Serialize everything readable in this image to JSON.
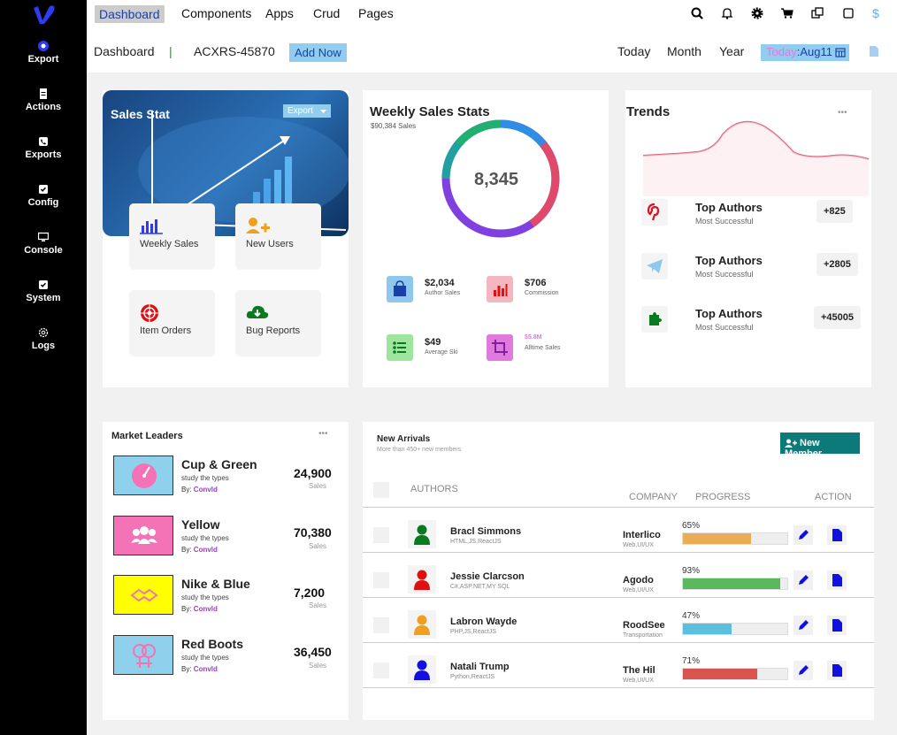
{
  "sidebar": {
    "items": [
      {
        "label": "Export",
        "icon": "gear-circle-icon"
      },
      {
        "label": "Actions",
        "icon": "document-icon"
      },
      {
        "label": "Exports",
        "icon": "phone-icon"
      },
      {
        "label": "Config",
        "icon": "check-square-icon"
      },
      {
        "label": "Console",
        "icon": "monitor-icon"
      },
      {
        "label": "System",
        "icon": "check-square-icon"
      },
      {
        "label": "Logs",
        "icon": "cog-outline-icon"
      }
    ]
  },
  "nav": {
    "items": [
      "Dashboard",
      "Components",
      "Apps",
      "Crud",
      "Pages"
    ],
    "active": "Dashboard"
  },
  "subheader": {
    "title": "Dashboard",
    "separator": "|",
    "code": "ACXRS-45870",
    "add_label": "Add Now",
    "ranges": [
      "Today",
      "Month",
      "Year"
    ],
    "today_prefix": "Today",
    "today_value": ":Aug11"
  },
  "sales_stat": {
    "title": "Sales Stat",
    "export_label": "Export",
    "tiles": [
      "Weekly Sales",
      "New Users",
      "Item Orders",
      "Bug Reports"
    ]
  },
  "weekly": {
    "title": "Weekly Sales Stats",
    "subtitle": "$90,384 Sales",
    "center": "8,345",
    "stats": [
      {
        "value": "$2,034",
        "label": "Author Sales",
        "color": "#8fc7ef"
      },
      {
        "value": "$706",
        "label": "Commission",
        "color": "#f4b7c0"
      },
      {
        "value": "$49",
        "label": "Average Ski",
        "color": "#9ee59e"
      },
      {
        "value": "$5.8M",
        "label": "Alltime Sales",
        "color": "#e07adf"
      }
    ]
  },
  "trends": {
    "title": "Trends",
    "more": "•••",
    "authors": [
      {
        "name": "Top Authors",
        "sub": "Most Successful",
        "badge": "+825",
        "icon": "pinterest-icon"
      },
      {
        "name": "Top Authors",
        "sub": "Most Successful",
        "badge": "+2805",
        "icon": "telegram-icon"
      },
      {
        "name": "Top Authors",
        "sub": "Most Successful",
        "badge": "+45005",
        "icon": "puzzle-icon"
      }
    ]
  },
  "market": {
    "title": "Market Leaders",
    "more": "•••",
    "items": [
      {
        "name": "Cup & Green",
        "sub": "study the types",
        "by": "By:",
        "author": "Conv",
        "suffix": "ld",
        "value": "24,900",
        "label": "Sales",
        "bg": "#8fd0ec"
      },
      {
        "name": "Yellow",
        "sub": "study the types",
        "by": "By:",
        "author": "Conv",
        "suffix": "ld",
        "value": "70,380",
        "label": "Sales",
        "bg": "#f472b6"
      },
      {
        "name": "Nike & Blue",
        "sub": "study the types",
        "by": "By:",
        "author": "Conv",
        "suffix": "ld",
        "value": "7,200",
        "label": "Sales",
        "bg": "#ffff00"
      },
      {
        "name": "Red Boots",
        "sub": "study the types",
        "by": "By:",
        "author": "Conv",
        "suffix": "ld",
        "value": "36,450",
        "label": "Sales",
        "bg": "#8fd0ec"
      }
    ]
  },
  "arrivals": {
    "title": "New Arrivals",
    "subtitle": "More than 450+ new members",
    "button": "New Member",
    "headers": {
      "authors": "AUTHORS",
      "company": "COMPANY",
      "progress": "PROGRESS",
      "action": "ACTION"
    },
    "rows": [
      {
        "name": "Bracl Simmons",
        "skills": "HTML,JS,ReactJS",
        "company": "Interlico",
        "type": "Web,UI/UX",
        "progress": 65,
        "pct": "65%",
        "color": "#e8ad55",
        "avatar": "#0a7a20"
      },
      {
        "name": "Jessie Clarcson",
        "skills": "C#,ASP.NET,MY SQL",
        "company": "Agodo",
        "type": "Web,UI/UX",
        "progress": 93,
        "pct": "93%",
        "color": "#5cb85c",
        "avatar": "#e01010"
      },
      {
        "name": "Labron Wayde",
        "skills": "PHP,JS,ReactJS",
        "company": "RoodSee",
        "type": "Transportation",
        "progress": 47,
        "pct": "47%",
        "color": "#5bc0de",
        "avatar": "#f0a020"
      },
      {
        "name": "Natali Trump",
        "skills": "Python,ReactJS",
        "company": "The Hil",
        "type": "Web,UI/UX",
        "progress": 71,
        "pct": "71%",
        "color": "#d9534f",
        "avatar": "#1010e0"
      }
    ]
  }
}
